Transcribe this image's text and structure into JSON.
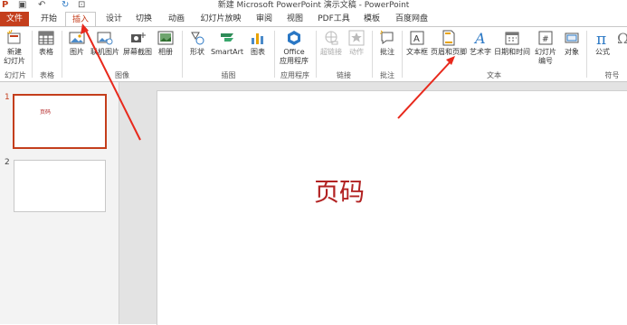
{
  "titlebar": {
    "title": "新建 Microsoft PowerPoint 演示文稿 - PowerPoint"
  },
  "tabs": [
    {
      "label": "文件"
    },
    {
      "label": "开始"
    },
    {
      "label": "插入"
    },
    {
      "label": "设计"
    },
    {
      "label": "切换"
    },
    {
      "label": "动画"
    },
    {
      "label": "幻灯片放映"
    },
    {
      "label": "审阅"
    },
    {
      "label": "视图"
    },
    {
      "label": "PDF工具"
    },
    {
      "label": "模板"
    },
    {
      "label": "百度网盘"
    }
  ],
  "ribbon": {
    "buttons": {
      "new_slide": "新建\n幻灯片",
      "table": "表格",
      "picture": "图片",
      "online_picture": "联机图片",
      "screenshot": "屏幕截图",
      "album": "相册",
      "shapes": "形状",
      "smartart": "SmartArt",
      "chart": "图表",
      "office_apps": "Office\n应用程序",
      "hyperlink": "超链接",
      "action": "动作",
      "comment": "批注",
      "textbox": "文本框",
      "header_footer": "页眉和页脚",
      "wordart": "艺术字",
      "datetime": "日期和时间",
      "slide_number": "幻灯片\n编号",
      "object": "对象",
      "equation": "公式"
    },
    "groups": {
      "slides": "幻灯片",
      "tables": "表格",
      "images": "图像",
      "illustrations": "插图",
      "apps": "应用程序",
      "links": "链接",
      "comments": "批注",
      "text": "文本",
      "symbols": "符号"
    }
  },
  "thumbnails": [
    {
      "number": "1",
      "text": "页码"
    },
    {
      "number": "2",
      "text": ""
    }
  ],
  "slide": {
    "text": "页码"
  },
  "colors": {
    "accent": "#c43e1c",
    "slide_text": "#b22222",
    "arrow": "#e8291c"
  }
}
